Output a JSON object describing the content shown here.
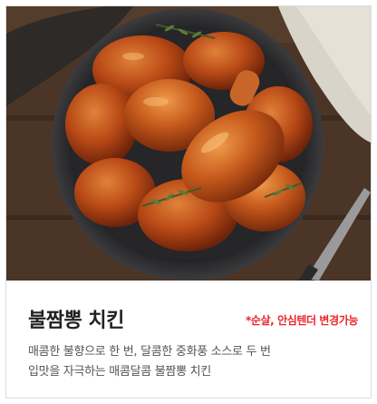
{
  "product": {
    "title": "불짬뽕 치킨",
    "note": "*순살, 안심텐더 변경가능",
    "description_lines": [
      "매콤한 불향으로 한 번, 달콤한 중화풍 소스로 두 번",
      "입맛을 자극하는 매콤달콤 불짬뽕 치킨"
    ]
  },
  "colors": {
    "note": "#e8262c",
    "title": "#222222",
    "description": "#555555"
  },
  "image": {
    "subject": "spicy glazed chicken pieces with rosemary on a dark plate"
  }
}
